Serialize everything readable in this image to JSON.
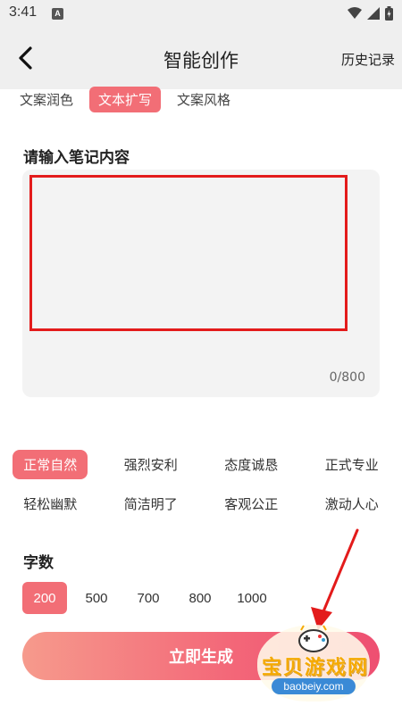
{
  "status_bar": {
    "time": "3:41",
    "app_icon_letter": "A",
    "icons": [
      "wifi-icon",
      "signal-icon",
      "battery-icon"
    ]
  },
  "header": {
    "title": "智能创作",
    "history_label": "历史记录"
  },
  "modes": [
    {
      "label": "文案润色",
      "active": false
    },
    {
      "label": "文本扩写",
      "active": true
    },
    {
      "label": "文案风格",
      "active": false
    }
  ],
  "editor": {
    "section_title": "请输入笔记内容",
    "counter": "0/800"
  },
  "styles": {
    "rows": [
      [
        {
          "label": "正常自然",
          "active": true
        },
        {
          "label": "强烈安利",
          "active": false
        },
        {
          "label": "态度诚恳",
          "active": false
        },
        {
          "label": "正式专业",
          "active": false
        }
      ],
      [
        {
          "label": "轻松幽默",
          "active": false
        },
        {
          "label": "简洁明了",
          "active": false
        },
        {
          "label": "客观公正",
          "active": false
        },
        {
          "label": "激动人心",
          "active": false
        }
      ]
    ]
  },
  "word_count": {
    "title": "字数",
    "options": [
      {
        "label": "200",
        "active": true
      },
      {
        "label": "500",
        "active": false
      },
      {
        "label": "700",
        "active": false
      },
      {
        "label": "800",
        "active": false
      },
      {
        "label": "1000",
        "active": false
      }
    ]
  },
  "actions": {
    "generate_label": "立即生成"
  },
  "watermark": {
    "text": "宝贝游戏网",
    "url": "baobeiy.com"
  },
  "colors": {
    "accent": "#f26e76",
    "highlight_box": "#e31b1b",
    "annotation_arrow": "#e31b1b"
  }
}
